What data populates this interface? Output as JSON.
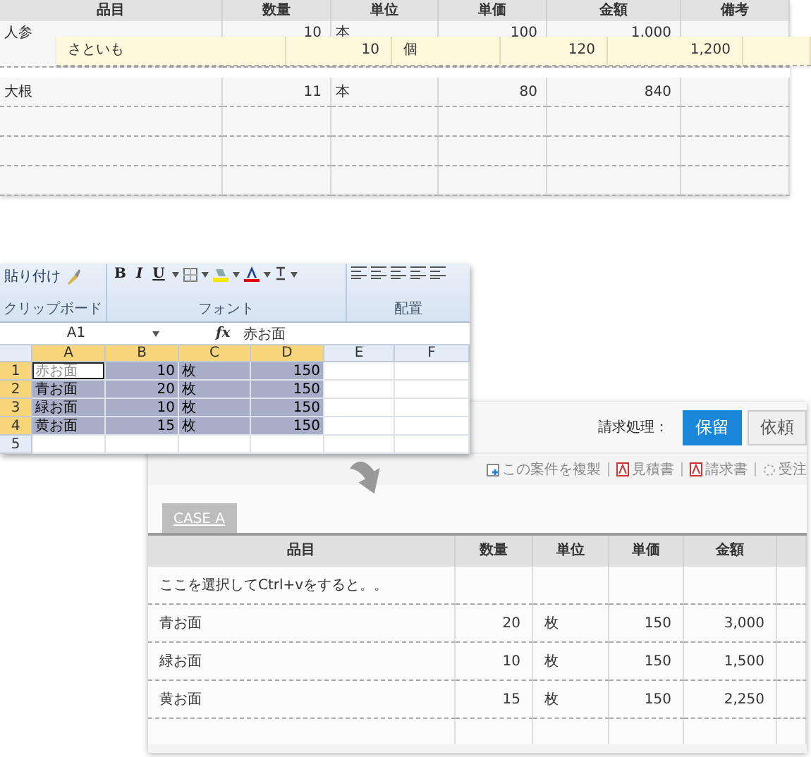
{
  "top_table": {
    "columns": [
      "品目",
      "数量",
      "単位",
      "単価",
      "金額",
      "備考"
    ],
    "rows": [
      {
        "cells": [
          "人参",
          "10",
          "本",
          "100",
          "1,000",
          ""
        ]
      },
      {
        "cells": [
          "大根",
          "11",
          "本",
          "80",
          "840",
          ""
        ]
      },
      {
        "cells": [
          "",
          "",
          "",
          "",
          "",
          ""
        ]
      },
      {
        "cells": [
          "",
          "",
          "",
          "",
          "",
          ""
        ]
      },
      {
        "cells": [
          "",
          "",
          "",
          "",
          "",
          ""
        ]
      }
    ],
    "dragged_row": {
      "cells": [
        "さといも",
        "10",
        "個",
        "120",
        "1,200",
        ""
      ]
    }
  },
  "excel": {
    "ribbon": {
      "paste_label": "貼り付け",
      "clipboard_label": "クリップボード",
      "font_buttons": [
        "B",
        "I",
        "U"
      ],
      "font_label": "フォント",
      "alignment_label": "配置"
    },
    "name_box": "A1",
    "fx": "fx",
    "formula": "赤お面",
    "columns": [
      {
        "label": "A",
        "selected": true
      },
      {
        "label": "B",
        "selected": true
      },
      {
        "label": "C",
        "selected": true
      },
      {
        "label": "D",
        "selected": true
      },
      {
        "label": "E",
        "selected": false
      },
      {
        "label": "F",
        "selected": false
      }
    ],
    "rows": [
      {
        "number": "1",
        "selected": true,
        "active": true,
        "cells": [
          "赤お面",
          "10",
          "枚",
          "150"
        ]
      },
      {
        "number": "2",
        "selected": true,
        "active": false,
        "cells": [
          "青お面",
          "20",
          "枚",
          "150"
        ]
      },
      {
        "number": "3",
        "selected": true,
        "active": false,
        "cells": [
          "緑お面",
          "10",
          "枚",
          "150"
        ]
      },
      {
        "number": "4",
        "selected": true,
        "active": false,
        "cells": [
          "黄お面",
          "15",
          "枚",
          "150"
        ]
      },
      {
        "number": "5",
        "selected": false,
        "active": false,
        "cells": [
          "",
          "",
          "",
          ""
        ]
      }
    ]
  },
  "web": {
    "billing_label": "請求処理：",
    "billing_options": [
      {
        "label": "保留",
        "selected": true
      },
      {
        "label": "依頼",
        "selected": false
      }
    ],
    "actions": [
      {
        "kind": "copy",
        "label": "この案件を複製"
      },
      {
        "kind": "pdf",
        "label": "見積書"
      },
      {
        "kind": "pdf",
        "label": "請求書"
      },
      {
        "kind": "order",
        "label": "受注"
      }
    ],
    "tab": "CASE A",
    "table": {
      "columns": [
        "品目",
        "数量",
        "単位",
        "単価",
        "金額"
      ],
      "rows": [
        {
          "cells": [
            "ここを選択してCtrl+vをすると。。",
            "",
            "",
            "",
            ""
          ]
        },
        {
          "cells": [
            "青お面",
            "20",
            "枚",
            "150",
            "3,000"
          ]
        },
        {
          "cells": [
            "緑お面",
            "10",
            "枚",
            "150",
            "1,500"
          ]
        },
        {
          "cells": [
            "黄お面",
            "15",
            "枚",
            "150",
            "2,250"
          ]
        },
        {
          "cells": [
            "",
            "",
            "",
            "",
            ""
          ]
        }
      ]
    }
  }
}
